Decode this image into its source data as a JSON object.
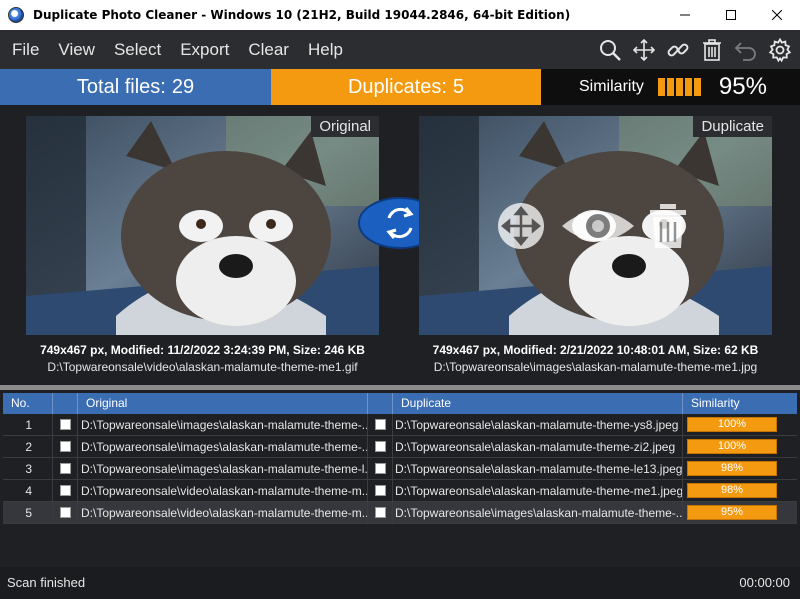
{
  "window": {
    "title": "Duplicate Photo Cleaner - Windows 10 (21H2, Build 19044.2846, 64-bit Edition)"
  },
  "menu": [
    "File",
    "View",
    "Select",
    "Export",
    "Clear",
    "Help"
  ],
  "toolbar_icons": [
    "search-icon",
    "move-icon",
    "link-icon",
    "trash-icon",
    "undo-icon",
    "gear-icon"
  ],
  "stats": {
    "total_label": "Total files:",
    "total_value": "29",
    "dup_label": "Duplicates:",
    "dup_value": "5",
    "sim_label": "Similarity",
    "sim_value": "95%"
  },
  "preview": {
    "original_tag": "Original",
    "duplicate_tag": "Duplicate",
    "original_meta": "749x467 px, Modified: 11/2/2022 3:24:39 PM, Size: 246 KB",
    "original_path": "D:\\Topwareonsale\\video\\alaskan-malamute-theme-me1.gif",
    "duplicate_meta": "749x467 px, Modified: 2/21/2022 10:48:01 AM, Size: 62 KB",
    "duplicate_path": "D:\\Topwareonsale\\images\\alaskan-malamute-theme-me1.jpg"
  },
  "table": {
    "headers": {
      "no": "No.",
      "original": "Original",
      "duplicate": "Duplicate",
      "similarity": "Similarity"
    },
    "rows": [
      {
        "no": "1",
        "original": "D:\\Topwareonsale\\images\\alaskan-malamute-theme-...",
        "duplicate": "D:\\Topwareonsale\\alaskan-malamute-theme-ys8.jpeg",
        "similarity": "100%"
      },
      {
        "no": "2",
        "original": "D:\\Topwareonsale\\images\\alaskan-malamute-theme-...",
        "duplicate": "D:\\Topwareonsale\\alaskan-malamute-theme-zi2.jpeg",
        "similarity": "100%"
      },
      {
        "no": "3",
        "original": "D:\\Topwareonsale\\images\\alaskan-malamute-theme-l...",
        "duplicate": "D:\\Topwareonsale\\alaskan-malamute-theme-le13.jpeg",
        "similarity": "98%"
      },
      {
        "no": "4",
        "original": "D:\\Topwareonsale\\video\\alaskan-malamute-theme-m...",
        "duplicate": "D:\\Topwareonsale\\alaskan-malamute-theme-me1.jpeg",
        "similarity": "98%"
      },
      {
        "no": "5",
        "original": "D:\\Topwareonsale\\video\\alaskan-malamute-theme-m...",
        "duplicate": "D:\\Topwareonsale\\images\\alaskan-malamute-theme-...",
        "similarity": "95%"
      }
    ]
  },
  "status": {
    "left": "Scan finished",
    "right": "00:00:00"
  },
  "colors": {
    "blue": "#3b6db3",
    "orange": "#f49a10",
    "background": "#1f2024"
  }
}
